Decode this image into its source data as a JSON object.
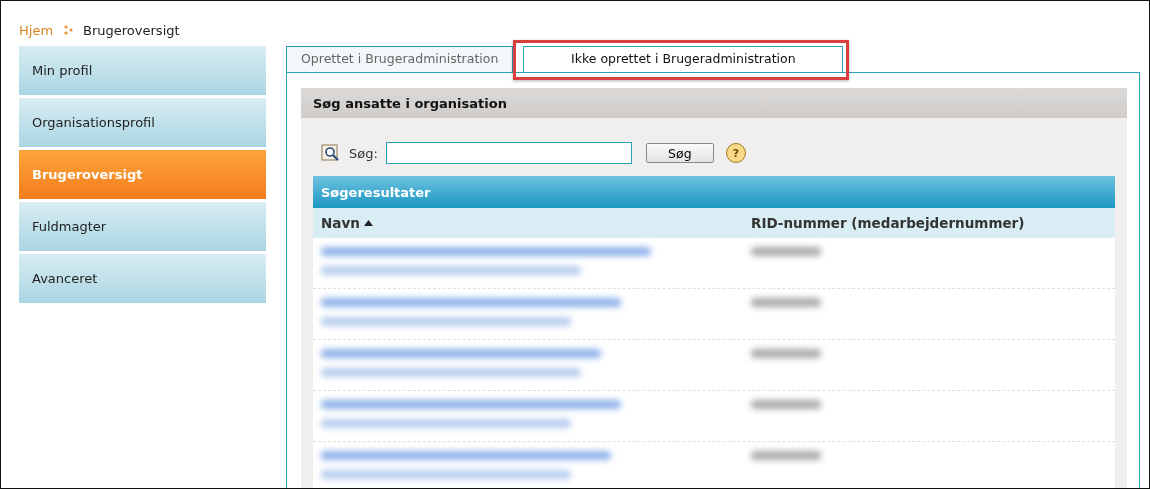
{
  "breadcrumb": [
    {
      "label": "Hjem",
      "link": true
    },
    {
      "label": "Brugeroversigt",
      "link": false
    }
  ],
  "sidebar": {
    "items": [
      {
        "label": "Min profil",
        "selected": false
      },
      {
        "label": "Organisationsprofil",
        "selected": false
      },
      {
        "label": "Brugeroversigt",
        "selected": true
      },
      {
        "label": "Fuldmagter",
        "selected": false
      },
      {
        "label": "Avanceret",
        "selected": false
      }
    ]
  },
  "tabs": [
    {
      "label": "Oprettet i Brugeradministration",
      "selected": false,
      "highlighted": false
    },
    {
      "label": "Ikke oprettet i Brugeradministration",
      "selected": true,
      "highlighted": true
    }
  ],
  "section": {
    "title": "Søg ansatte i organisation"
  },
  "search": {
    "label": "Søg:",
    "button": "Søg",
    "help": "?"
  },
  "results": {
    "title": "Søgeresultater",
    "columns": [
      {
        "label": "Navn",
        "sorted": true
      },
      {
        "label": "RID-nummer (medarbejdernummer)",
        "sorted": false
      }
    ],
    "rows": [
      {
        "kind": "redacted"
      },
      {
        "kind": "redacted"
      },
      {
        "kind": "redacted"
      },
      {
        "kind": "redacted"
      },
      {
        "kind": "redacted"
      }
    ]
  }
}
